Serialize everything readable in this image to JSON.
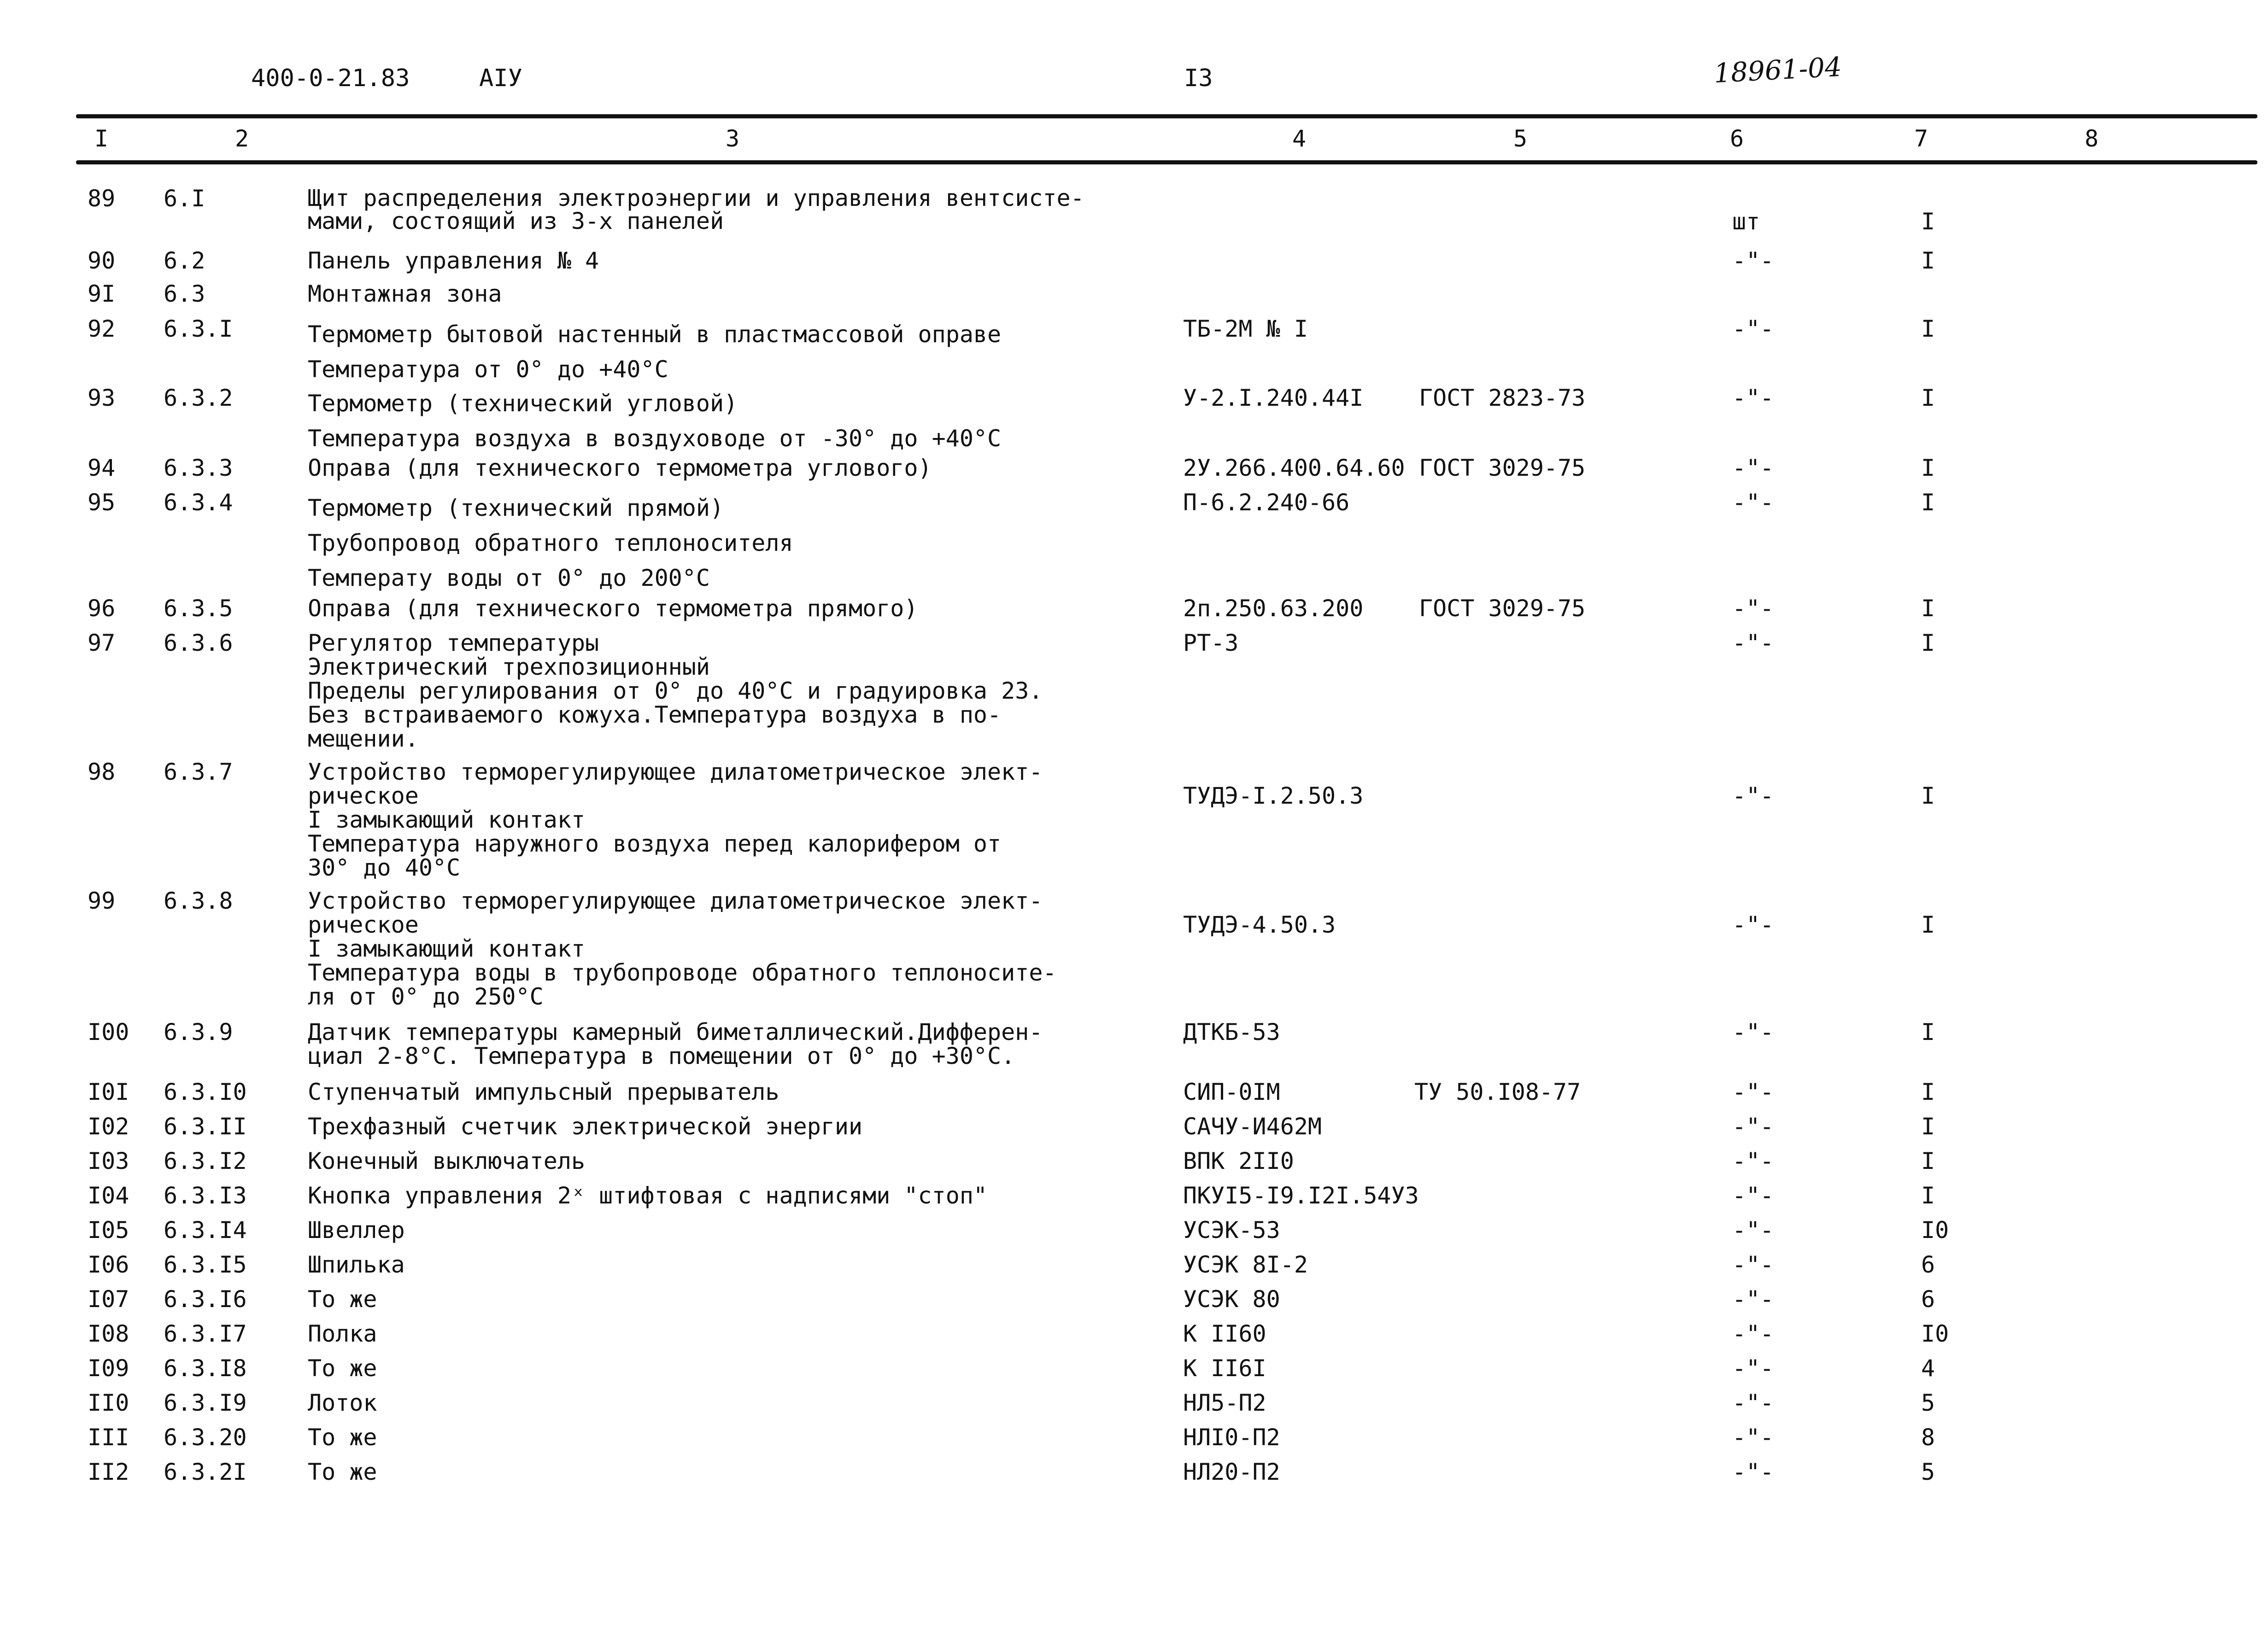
{
  "header": {
    "doc_code": "400-0-21.83",
    "album": "АIУ",
    "page": "I3",
    "stamp": "18961-04"
  },
  "columns": [
    "I",
    "2",
    "3",
    "4",
    "5",
    "6",
    "7",
    "8"
  ],
  "rows": [
    {
      "no": "89",
      "pos": "6.I",
      "name": [
        "Щит распределения электроэнергии и управления вентсисте-",
        "мами, состоящий из 3-х панелей"
      ],
      "type": "",
      "doc": "",
      "unit": "шт",
      "qty": "I"
    },
    {
      "no": "90",
      "pos": "6.2",
      "name": [
        "Панель управления № 4"
      ],
      "type": "",
      "doc": "",
      "unit": "-\"-",
      "qty": "I"
    },
    {
      "no": "9I",
      "pos": "6.3",
      "name": [
        "Монтажная зона"
      ],
      "type": "",
      "doc": "",
      "unit": "",
      "qty": ""
    },
    {
      "no": "92",
      "pos": "6.3.I",
      "name": [
        "Термометр бытовой настенный в пластмассовой оправе",
        "Температура от 0° до +40°С"
      ],
      "type": "ТБ-2М № I",
      "doc": "",
      "unit": "-\"-",
      "qty": "I"
    },
    {
      "no": "93",
      "pos": "6.3.2",
      "name": [
        "Термометр (технический угловой)",
        "Температура воздуха в воздуховоде от -30° до +40°С"
      ],
      "type": "У-2.I.240.44I",
      "doc": "ГОСТ 2823-73",
      "unit": "-\"-",
      "qty": "I"
    },
    {
      "no": "94",
      "pos": "6.3.3",
      "name": [
        "Оправа (для технического термометра углового)"
      ],
      "type": "2У.266.400.64.60",
      "doc": "ГОСТ 3029-75",
      "unit": "-\"-",
      "qty": "I"
    },
    {
      "no": "95",
      "pos": "6.3.4",
      "name": [
        "Термометр (технический прямой)",
        "Трубопровод обратного теплоносителя",
        "Температу воды от 0° до 200°С"
      ],
      "type": "П-6.2.240-66",
      "doc": "",
      "unit": "-\"-",
      "qty": "I"
    },
    {
      "no": "96",
      "pos": "6.3.5",
      "name": [
        "Оправа (для технического термометра прямого)"
      ],
      "type": "2п.250.63.200",
      "doc": "ГОСТ 3029-75",
      "unit": "-\"-",
      "qty": "I"
    },
    {
      "no": "97",
      "pos": "6.3.6",
      "name": [
        "Регулятор температуры",
        "Электрический трехпозиционный",
        "Пределы регулирования от 0° до 40°С и градуировка 23.",
        "Без встраиваемого кожуха.Температура воздуха в по-",
        "мещении."
      ],
      "type": "РТ-3",
      "doc": "",
      "unit": "-\"-",
      "qty": "I"
    },
    {
      "no": "98",
      "pos": "6.3.7",
      "name": [
        "Устройство терморегулирующее дилатометрическое элект-",
        "рическое",
        "I замыкающий контакт",
        "Температура наружного воздуха перед калорифером от",
        "30° до 40°С"
      ],
      "type": "ТУДЭ-I.2.50.3",
      "doc": "",
      "unit": "-\"-",
      "qty": "I"
    },
    {
      "no": "99",
      "pos": "6.3.8",
      "name": [
        "Устройство терморегулирующее дилатометрическое элект-",
        "рическое",
        "I замыкающий контакт",
        "Температура воды в трубопроводе обратного теплоносите-",
        "ля от 0° до 250°С"
      ],
      "type": "ТУДЭ-4.50.3",
      "doc": "",
      "unit": "-\"-",
      "qty": "I"
    },
    {
      "no": "I00",
      "pos": "6.3.9",
      "name": [
        "Датчик температуры камерный биметаллический.Дифферен-",
        "циал 2-8°С. Температура в помещении от 0° до +30°С."
      ],
      "type": "ДТКБ-53",
      "doc": "",
      "unit": "-\"-",
      "qty": "I"
    },
    {
      "no": "I0I",
      "pos": "6.3.I0",
      "name": [
        "Ступенчатый импульсный прерыватель"
      ],
      "type": "СИП-0IМ",
      "doc": "ТУ 50.I08-77",
      "unit": "-\"-",
      "qty": "I"
    },
    {
      "no": "I02",
      "pos": "6.3.II",
      "name": [
        "Трехфазный счетчик электрической энергии"
      ],
      "type": "САЧУ-И462М",
      "doc": "",
      "unit": "-\"-",
      "qty": "I"
    },
    {
      "no": "I03",
      "pos": "6.3.I2",
      "name": [
        "Конечный выключатель"
      ],
      "type": "ВПК 2II0",
      "doc": "",
      "unit": "-\"-",
      "qty": "I"
    },
    {
      "no": "I04",
      "pos": "6.3.I3",
      "name": [
        "Кнопка управления 2ˣ штифтовая с надписями \"стоп\""
      ],
      "type": "ПКУI5-I9.I2I.54У3",
      "doc": "",
      "unit": "-\"-",
      "qty": "I"
    },
    {
      "no": "I05",
      "pos": "6.3.I4",
      "name": [
        "Швеллер"
      ],
      "type": "УСЭК-53",
      "doc": "",
      "unit": "-\"-",
      "qty": "I0"
    },
    {
      "no": "I06",
      "pos": "6.3.I5",
      "name": [
        "Шпилька"
      ],
      "type": "УСЭК 8I-2",
      "doc": "",
      "unit": "-\"-",
      "qty": "6"
    },
    {
      "no": "I07",
      "pos": "6.3.I6",
      "name": [
        "То же"
      ],
      "type": "УСЭК 80",
      "doc": "",
      "unit": "-\"-",
      "qty": "6"
    },
    {
      "no": "I08",
      "pos": "6.3.I7",
      "name": [
        "Полка"
      ],
      "type": "К II60",
      "doc": "",
      "unit": "-\"-",
      "qty": "I0"
    },
    {
      "no": "I09",
      "pos": "6.3.I8",
      "name": [
        "То же"
      ],
      "type": "К II6I",
      "doc": "",
      "unit": "-\"-",
      "qty": "4"
    },
    {
      "no": "II0",
      "pos": "6.3.I9",
      "name": [
        "Лоток"
      ],
      "type": "НЛ5-П2",
      "doc": "",
      "unit": "-\"-",
      "qty": "5"
    },
    {
      "no": "III",
      "pos": "6.3.20",
      "name": [
        "То же"
      ],
      "type": "НЛI0-П2",
      "doc": "",
      "unit": "-\"-",
      "qty": "8"
    },
    {
      "no": "II2",
      "pos": "6.3.2I",
      "name": [
        "То же"
      ],
      "type": "НЛ20-П2",
      "doc": "",
      "unit": "-\"-",
      "qty": "5"
    }
  ]
}
